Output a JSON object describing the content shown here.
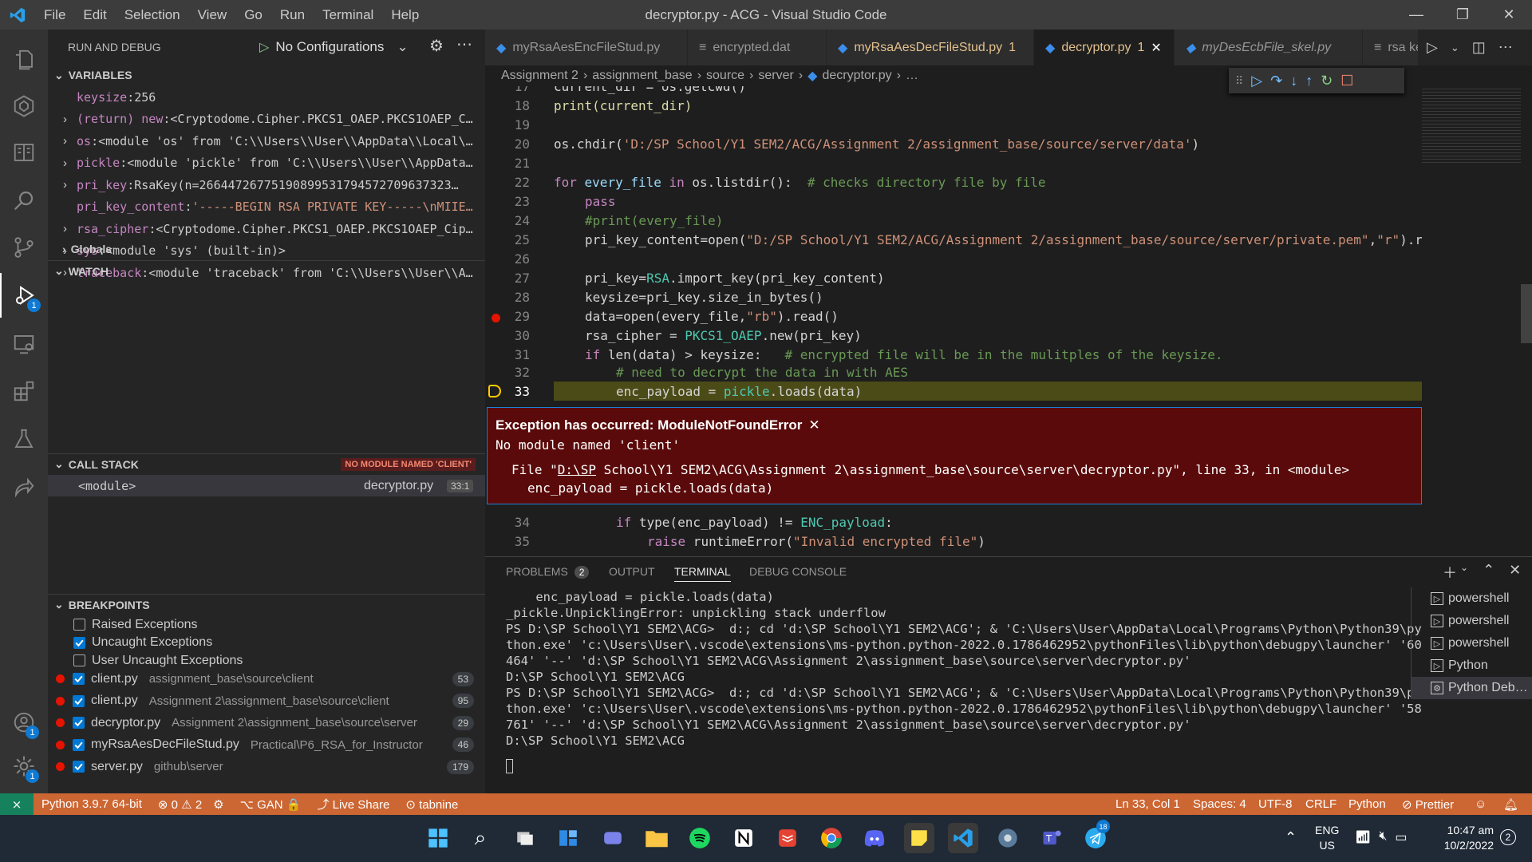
{
  "window": {
    "title": "decryptor.py - ACG - Visual Studio Code",
    "menu": [
      "File",
      "Edit",
      "Selection",
      "View",
      "Go",
      "Run",
      "Terminal",
      "Help"
    ]
  },
  "colors": {
    "status_bar": "#cc6633",
    "exception_bg": "#5a0a0a",
    "current_line": "#4b4b18",
    "accent": "#0e7ad3"
  },
  "sidebar": {
    "title": "RUN AND DEBUG",
    "config": "No Configurations",
    "variables_header": "VARIABLES",
    "variables": [
      {
        "name": "keysize",
        "value": "256",
        "expandable": false
      },
      {
        "name": "(return) new",
        "value": "<Cryptodome.Cipher.PKCS1_OAEP.PKCS1OAEP_C…",
        "expandable": true
      },
      {
        "name": "os",
        "value": "<module 'os' from 'C:\\\\Users\\\\User\\\\AppData\\\\Local\\…",
        "expandable": true
      },
      {
        "name": "pickle",
        "value": "<module 'pickle' from 'C:\\\\Users\\\\User\\\\AppData…",
        "expandable": true
      },
      {
        "name": "pri_key",
        "value": "RsaKey(n=26644726775190899531794572709637323…",
        "expandable": true
      },
      {
        "name": "pri_key_content",
        "value": "'-----BEGIN RSA PRIVATE KEY-----\\nMIIE…",
        "expandable": false
      },
      {
        "name": "rsa_cipher",
        "value": "<Cryptodome.Cipher.PKCS1_OAEP.PKCS1OAEP_Cip…",
        "expandable": true
      },
      {
        "name": "sys",
        "value": "<module 'sys' (built-in)>",
        "expandable": true
      },
      {
        "name": "traceback",
        "value": "<module 'traceback' from 'C:\\\\Users\\\\User\\\\A…",
        "expandable": true
      }
    ],
    "globals_label": "Globals",
    "watch_header": "WATCH",
    "callstack_header": "CALL STACK",
    "callstack_badge": "NO MODULE NAMED 'CLIENT'",
    "callstack": [
      {
        "frame": "<module>",
        "file": "decryptor.py",
        "pos": "33:1"
      }
    ],
    "breakpoints_header": "BREAKPOINTS",
    "exception_bps": [
      {
        "label": "Raised Exceptions",
        "checked": false
      },
      {
        "label": "Uncaught Exceptions",
        "checked": true
      },
      {
        "label": "User Uncaught Exceptions",
        "checked": false
      }
    ],
    "file_bps": [
      {
        "file": "client.py",
        "path": "assignment_base\\source\\client",
        "line": "53"
      },
      {
        "file": "client.py",
        "path": "Assignment 2\\assignment_base\\source\\client",
        "line": "95"
      },
      {
        "file": "decryptor.py",
        "path": "Assignment 2\\assignment_base\\source\\server",
        "line": "29"
      },
      {
        "file": "myRsaAesDecFileStud.py",
        "path": "Practical\\P6_RSA_for_Instructor",
        "line": "46"
      },
      {
        "file": "server.py",
        "path": "github\\server",
        "line": "179"
      }
    ]
  },
  "tabs": [
    {
      "label": "myRsaAesEncFileStud.py",
      "suffix": ""
    },
    {
      "label": "encrypted.dat",
      "suffix": ""
    },
    {
      "label": "myRsaAesDecFileStud.py",
      "suffix": "1"
    },
    {
      "label": "decryptor.py",
      "suffix": "1"
    },
    {
      "label": "myDesEcbFile_skel.py",
      "suffix": ""
    },
    {
      "label": "rsa key",
      "suffix": ""
    }
  ],
  "breadcrumb": [
    "Assignment 2",
    "assignment_base",
    "source",
    "server",
    "decryptor.py",
    "…"
  ],
  "code": {
    "line17": "17",
    "t17": "current_dir = os.getcwd()",
    "line18": "18",
    "t18": "print(current_dir)",
    "line19": "19",
    "line20": "20",
    "t20a": "os.chdir(",
    "t20b": "'D:/SP School/Y1 SEM2/ACG/Assignment 2/assignment_base/source/server/data'",
    "t20c": ")",
    "line21": "21",
    "line22": "22",
    "t22a": "for",
    "t22b": " every_file ",
    "t22c": "in",
    "t22d": " os.listdir():  ",
    "t22e": "# checks directory file by file",
    "line23": "23",
    "t23": "pass",
    "line24": "24",
    "t24": "#print(every_file)",
    "line25": "25",
    "t25a": "pri_key_content=open(",
    "t25b": "\"D:/SP School/Y1 SEM2/ACG/Assignment 2/assignment_base/source/server/private.pem\"",
    "t25c": ",",
    "t25d": "\"r\"",
    "t25e": ").r",
    "line26": "26",
    "line27": "27",
    "t27a": "pri_key=",
    "t27b": "RSA",
    "t27c": ".import_key(pri_key_content)",
    "line28": "28",
    "t28": "keysize=pri_key.size_in_bytes()",
    "line29": "29",
    "t29a": "data=open(every_file,",
    "t29b": "\"rb\"",
    "t29c": ").read()",
    "line30": "30",
    "t30a": "rsa_cipher = ",
    "t30b": "PKCS1_OAEP",
    "t30c": ".new(pri_key)",
    "line31": "31",
    "t31a": "if",
    "t31b": " len(data) > keysize:   ",
    "t31c": "# encrypted file will be in the mulitples of the keysize.",
    "line32": "32",
    "t32": "# need to decrypt the data in with AES",
    "line33": "33",
    "t33a": "enc_payload = ",
    "t33b": "pickle",
    "t33c": ".loads(data)",
    "line34": "34",
    "t34a": "if",
    "t34b": " type(enc_payload) != ",
    "t34c": "ENC_payload",
    "t34d": ":",
    "line35": "35",
    "t35a": "raise",
    "t35b": " runtimeError(",
    "t35c": "\"Invalid encrypted file\"",
    "t35d": ")"
  },
  "exception": {
    "title": "Exception has occurred: ModuleNotFoundError",
    "message": "No module named 'client'",
    "trace1_pre": "File \"",
    "trace1_link": "D:\\SP",
    "trace1_post": " School\\Y1 SEM2\\ACG\\Assignment 2\\assignment_base\\source\\server\\decryptor.py\", line 33, in <module>",
    "trace2": "enc_payload = pickle.loads(data)"
  },
  "panel": {
    "tabs": [
      "PROBLEMS",
      "OUTPUT",
      "TERMINAL",
      "DEBUG CONSOLE"
    ],
    "problems_count": "2",
    "terminal": [
      "    enc_payload = pickle.loads(data)",
      "_pickle.UnpicklingError: unpickling stack underflow",
      "PS D:\\SP School\\Y1 SEM2\\ACG>  d:; cd 'd:\\SP School\\Y1 SEM2\\ACG'; & 'C:\\Users\\User\\AppData\\Local\\Programs\\Python\\Python39\\py",
      "thon.exe' 'c:\\Users\\User\\.vscode\\extensions\\ms-python.python-2022.0.1786462952\\pythonFiles\\lib\\python\\debugpy\\launcher' '60",
      "464' '--' 'd:\\SP School\\Y1 SEM2\\ACG\\Assignment 2\\assignment_base\\source\\server\\decryptor.py'",
      "D:\\SP School\\Y1 SEM2\\ACG",
      "PS D:\\SP School\\Y1 SEM2\\ACG>  d:; cd 'd:\\SP School\\Y1 SEM2\\ACG'; & 'C:\\Users\\User\\AppData\\Local\\Programs\\Python\\Python39\\py",
      "thon.exe' 'c:\\Users\\User\\.vscode\\extensions\\ms-python.python-2022.0.1786462952\\pythonFiles\\lib\\python\\debugpy\\launcher' '58",
      "761' '--' 'd:\\SP School\\Y1 SEM2\\ACG\\Assignment 2\\assignment_base\\source\\server\\decryptor.py'",
      "D:\\SP School\\Y1 SEM2\\ACG"
    ],
    "terminals": [
      "powershell",
      "powershell",
      "powershell",
      "Python",
      "Python Deb…"
    ]
  },
  "status": {
    "python": "Python 3.9.7 64-bit",
    "errors": "0",
    "warnings": "2",
    "branch": "GAN",
    "liveshare": "Live Share",
    "tabnine": "tabnine",
    "position": "Ln 33, Col 1",
    "spaces": "Spaces: 4",
    "encoding": "UTF-8",
    "eol": "CRLF",
    "language": "Python",
    "prettier": "Prettier"
  },
  "taskbar": {
    "lang1": "ENG",
    "lang2": "US",
    "time": "10:47 am",
    "date": "10/2/2022",
    "notif": "2",
    "telegram_badge": "18"
  }
}
